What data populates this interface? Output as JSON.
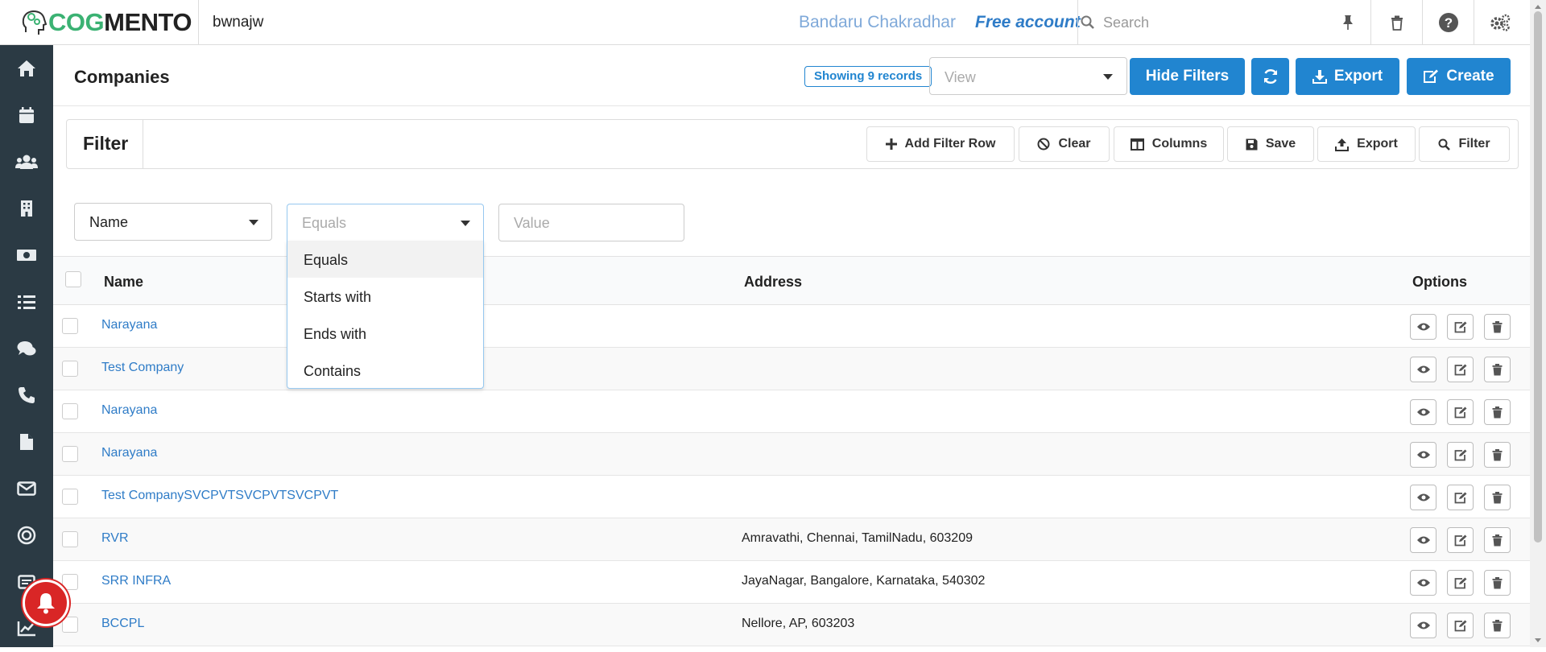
{
  "topbar": {
    "logo_prefix": "COG",
    "logo_suffix": "MENTO",
    "workspace": "bwnajw",
    "user_name": "Bandaru Chakradhar",
    "account_type": "Free account",
    "search_placeholder": "Search"
  },
  "sidebar": {
    "items": [
      "home-icon",
      "calendar-icon",
      "contacts-icon",
      "companies-icon",
      "deals-icon",
      "tasks-icon",
      "cases-icon",
      "calls-icon",
      "documents-icon",
      "email-icon",
      "campaigns-icon",
      "forms-icon",
      "reports-icon"
    ]
  },
  "header": {
    "title": "Companies",
    "records_badge": "Showing 9 records",
    "view_placeholder": "View",
    "hide_filters_label": "Hide Filters",
    "export_label": "Export",
    "create_label": "Create"
  },
  "filter_bar": {
    "title": "Filter",
    "add_row_label": "Add Filter Row",
    "clear_label": "Clear",
    "columns_label": "Columns",
    "save_label": "Save",
    "export_label": "Export",
    "filter_label": "Filter"
  },
  "filter_row": {
    "field_value": "Name",
    "operator_placeholder": "Equals",
    "value_placeholder": "Value"
  },
  "dropdown": {
    "options": [
      "Equals",
      "Starts with",
      "Ends with",
      "Contains"
    ],
    "selected": "Equals"
  },
  "table": {
    "columns": [
      "Name",
      "Address",
      "Options"
    ],
    "rows": [
      {
        "name": "Narayana",
        "address": ""
      },
      {
        "name": "Test Company",
        "address": ""
      },
      {
        "name": "Narayana",
        "address": ""
      },
      {
        "name": "Narayana",
        "address": ""
      },
      {
        "name": "Test CompanySVCPVTSVCPVTSVCPVT",
        "address": ""
      },
      {
        "name": "RVR",
        "address": "Amravathi, Chennai, TamilNadu, 603209"
      },
      {
        "name": "SRR INFRA",
        "address": "JayaNagar, Bangalore, Karnataka, 540302"
      },
      {
        "name": "BCCPL",
        "address": "Nellore, AP, 603203"
      }
    ]
  },
  "colors": {
    "primary": "#2185d0",
    "sidebar": "#2b3a44",
    "link": "#2f7cc7",
    "brand_green": "#3bb273",
    "notification": "#d92626"
  }
}
